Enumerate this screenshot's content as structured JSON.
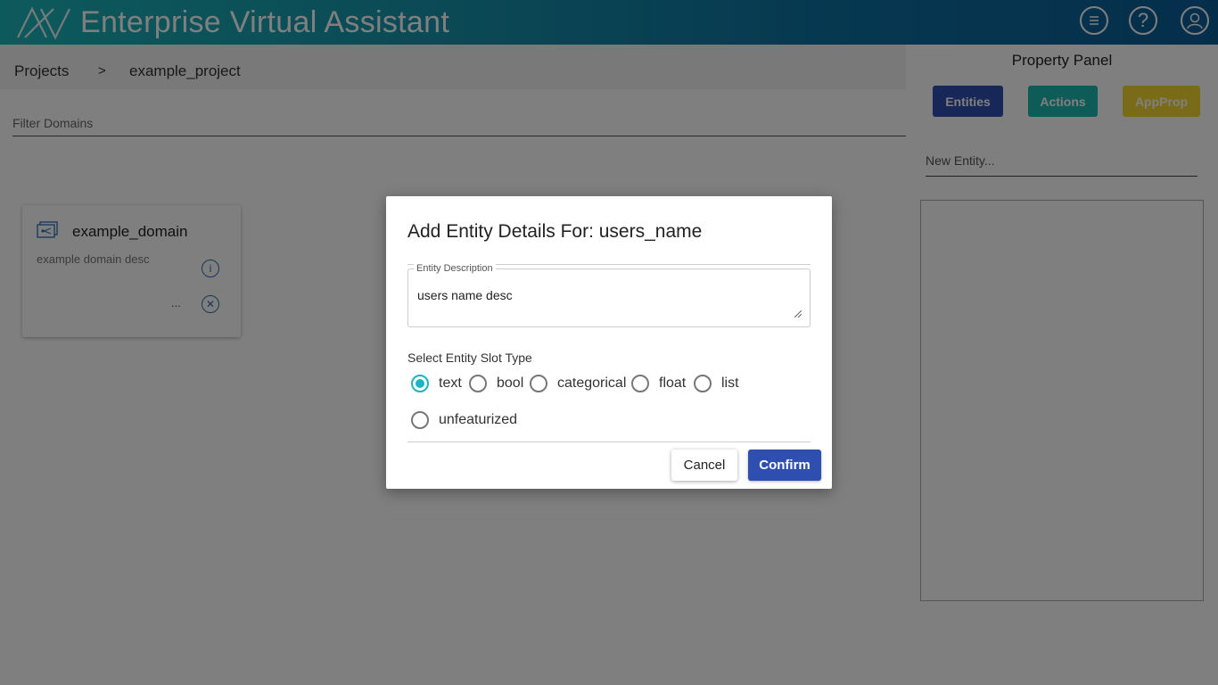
{
  "header": {
    "app_title": "Enterprise Virtual Assistant",
    "icons": [
      "menu-icon",
      "help-icon",
      "user-icon"
    ],
    "colors": {
      "gradient_start": "#1ab4b8",
      "gradient_end": "#0b5d97"
    }
  },
  "breadcrumb": {
    "projects": "Projects",
    "separator": ">",
    "project": "example_project"
  },
  "filter": {
    "placeholder": "Filter Domains"
  },
  "domains": [
    {
      "name": "example_domain",
      "description": "example domain desc",
      "more": "..."
    }
  ],
  "panel": {
    "title": "Property Panel",
    "tabs": [
      "Entities",
      "Actions",
      "AppProp"
    ],
    "tab_colors": [
      "#2f4fb0",
      "#1cb8b0",
      "#f2d730"
    ],
    "new_entity_placeholder": "New Entity..."
  },
  "dialog": {
    "title": "Add Entity Details For: users_name",
    "description_label": "Entity Description",
    "description_value": "users name desc",
    "slot_type_label": "Select Entity Slot Type",
    "slot_options": [
      "text",
      "bool",
      "categorical",
      "float",
      "list",
      "unfeaturized"
    ],
    "selected_slot": "text",
    "cancel_label": "Cancel",
    "confirm_label": "Confirm",
    "accent_color": "#1bb4c4"
  }
}
